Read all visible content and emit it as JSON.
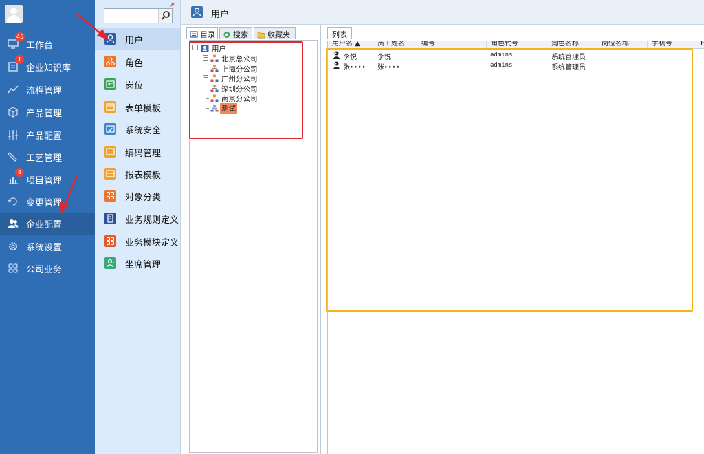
{
  "nav": {
    "items": [
      {
        "label": "工作台",
        "icon": "monitor-icon",
        "badge": "45"
      },
      {
        "label": "企业知识库",
        "icon": "book-icon",
        "badge": "1"
      },
      {
        "label": "流程管理",
        "icon": "flow-icon",
        "badge": ""
      },
      {
        "label": "产品管理",
        "icon": "cube-icon",
        "badge": ""
      },
      {
        "label": "产品配置",
        "icon": "sliders-icon",
        "badge": ""
      },
      {
        "label": "工艺管理",
        "icon": "wrench-icon",
        "badge": ""
      },
      {
        "label": "项目管理",
        "icon": "chart-icon",
        "badge": "9"
      },
      {
        "label": "变更管理",
        "icon": "change-icon",
        "badge": ""
      },
      {
        "label": "企业配置",
        "icon": "users-icon",
        "badge": "",
        "active": true
      },
      {
        "label": "系统设置",
        "icon": "gear-icon",
        "badge": ""
      },
      {
        "label": "公司业务",
        "icon": "grid-icon",
        "badge": ""
      }
    ]
  },
  "submenu": {
    "search_value": "",
    "items": [
      {
        "label": "用户",
        "color": "#2f5fa8",
        "active": true
      },
      {
        "label": "角色",
        "color": "#e9772f"
      },
      {
        "label": "岗位",
        "color": "#3aa05a"
      },
      {
        "label": "表单模板",
        "color": "#f0a32c"
      },
      {
        "label": "系统安全",
        "color": "#3a86c8"
      },
      {
        "label": "编码管理",
        "color": "#f0a32c"
      },
      {
        "label": "报表模板",
        "color": "#f0a32c"
      },
      {
        "label": "对象分类",
        "color": "#e9772f"
      },
      {
        "label": "业务规则定义",
        "color": "#2f4fa0"
      },
      {
        "label": "业务模块定义",
        "color": "#e55a2a"
      },
      {
        "label": "坐席管理",
        "color": "#3aa878"
      }
    ]
  },
  "main": {
    "title": "用户",
    "tree_tabs": [
      "目录",
      "搜索",
      "收藏夹"
    ],
    "tree": {
      "root": "用户",
      "nodes": [
        "北京总公司",
        "上海分公司",
        "广州分公司",
        "深圳分公司",
        "南京分公司",
        "测试"
      ]
    },
    "list_tab": "列表",
    "grid": {
      "columns": [
        "用户名 ▲",
        "员工姓名",
        "编号",
        "角色代号",
        "角色名称",
        "岗位名称",
        "手机号",
        "E"
      ],
      "rows": [
        {
          "username": "李悦",
          "name": "李悦",
          "number": "",
          "role_code": "admins",
          "role_name": "系统管理员"
        },
        {
          "username": "张‣‣‣‣",
          "name": "张‣‣‣‣",
          "number": "",
          "role_code": "admins",
          "role_name": "系统管理员"
        }
      ]
    }
  },
  "colors": {
    "nav_bg": "#2f6db5",
    "submenu_bg": "#dcebfb",
    "annotation_red": "#e3262d",
    "annotation_yellow": "#f4b31d"
  }
}
